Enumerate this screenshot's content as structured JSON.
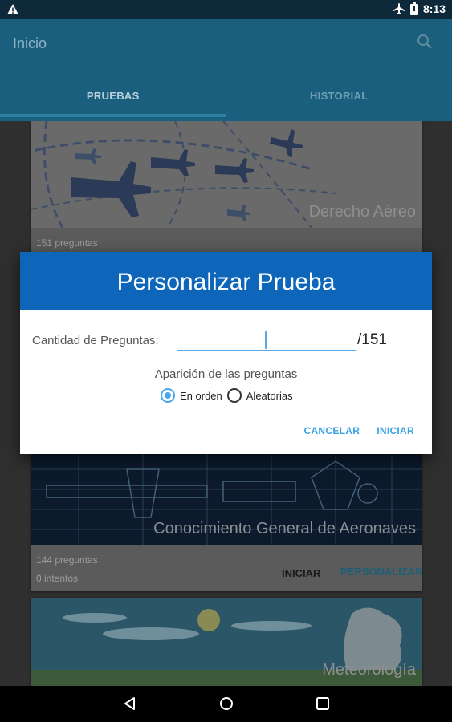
{
  "status_bar": {
    "time": "8:13",
    "icons": [
      "warning-icon",
      "airplane-mode-icon",
      "battery-icon"
    ]
  },
  "app_bar": {
    "title": "Inicio",
    "search_icon": "search-icon"
  },
  "tabs": [
    {
      "label": "PRUEBAS",
      "active": true
    },
    {
      "label": "HISTORIAL",
      "active": false
    }
  ],
  "cards": [
    {
      "title": "Derecho Aéreo",
      "questions": "151 preguntas"
    },
    {
      "title": "Conocimiento General de Aeronaves",
      "questions": "144 preguntas",
      "attempts": "0 intentos",
      "start_label": "INICIAR",
      "customize_label": "PERSONALIZAR"
    },
    {
      "title": "Meteorología"
    }
  ],
  "dialog": {
    "title": "Personalizar Prueba",
    "quantity_label": "Cantidad de Preguntas:",
    "quantity_value": "",
    "quantity_total": "/151",
    "order_title": "Aparición de las preguntas",
    "options": [
      {
        "label": "En orden",
        "selected": true
      },
      {
        "label": "Aleatorias",
        "selected": false
      }
    ],
    "cancel_label": "CANCELAR",
    "start_label": "INICIAR"
  },
  "nav_bar": {
    "icons": [
      "back-icon",
      "home-icon",
      "recents-icon"
    ]
  },
  "colors": {
    "dialog_header": "#0d66b9",
    "accent": "#3aa2e6",
    "app_bar": "#1b5f7e"
  }
}
